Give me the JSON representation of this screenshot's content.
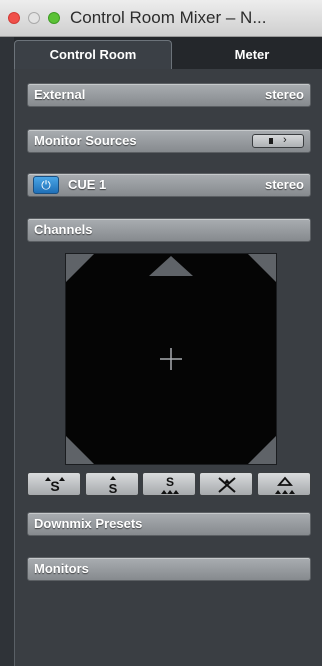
{
  "window": {
    "title": "Control Room Mixer – N..."
  },
  "tabs": [
    {
      "label": "Control Room",
      "active": true
    },
    {
      "label": "Meter",
      "active": false
    }
  ],
  "sections": {
    "external": {
      "label": "External",
      "value": "stereo"
    },
    "monitor_sources": {
      "label": "Monitor Sources"
    },
    "cue": {
      "label": "CUE 1",
      "value": "stereo",
      "power_icon": "power-icon",
      "power_on": true
    },
    "channels": {
      "label": "Channels"
    },
    "downmix_presets": {
      "label": "Downmix Presets"
    },
    "monitors": {
      "label": "Monitors"
    }
  },
  "surround_pad": {
    "center_icon": "crosshair-icon",
    "speaker_icons": [
      "front-center-speaker-icon",
      "front-left-speaker-icon",
      "front-right-speaker-icon",
      "rear-left-speaker-icon",
      "rear-right-speaker-icon"
    ]
  },
  "mode_buttons": [
    {
      "icon": "spread-surround-icon"
    },
    {
      "icon": "stereo-spread-icon"
    },
    {
      "icon": "surround-spread-icon"
    },
    {
      "icon": "collapse-center-icon"
    },
    {
      "icon": "front-only-icon"
    }
  ],
  "colors": {
    "panel_bg": "#3a3e43",
    "bar_gray": "#9a9ea2",
    "power_blue": "#2b86d6"
  }
}
